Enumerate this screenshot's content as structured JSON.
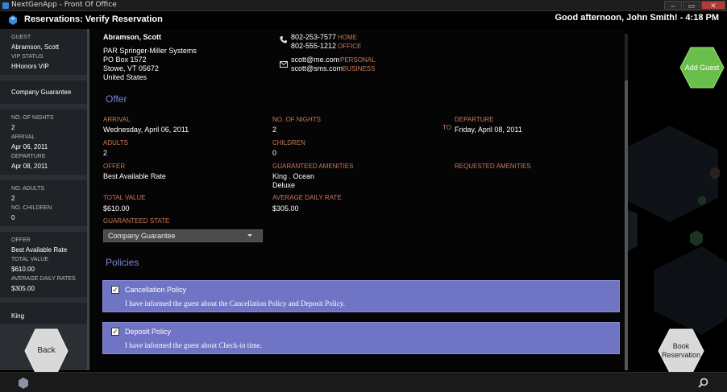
{
  "window": {
    "title": "NextGenApp - Front Of Office",
    "controls": [
      "–",
      "▭",
      "✕"
    ]
  },
  "header": {
    "title": "Reservations: Verify Reservation",
    "greeting": "Good afternoon, John Smith! - 4:18 PM"
  },
  "sidebar": {
    "guest_label": "GUEST",
    "guest_value": "Abramson, Scott",
    "vip_label": "VIP STATUS",
    "vip_value": "HHonors VIP",
    "guarantee": "Company Guarantee",
    "nights_label": "NO. OF NIGHTS",
    "nights_value": "2",
    "arrival_label": "ARRIVAL",
    "arrival_value": "Apr 06, 2011",
    "departure_label": "DEPARTURE",
    "departure_value": "Apr 08, 2011",
    "adults_label": "NO. ADULTS",
    "adults_value": "2",
    "children_label": "NO. CHILDREN",
    "children_value": "0",
    "offer_label": "OFFER",
    "offer_value": "Best Available Rate",
    "total_label": "TOTAL VALUE",
    "total_value": "$610.00",
    "adr_label": "AVERAGE DAILY RATES",
    "adr_value": "$305.00",
    "room_value": "King"
  },
  "contact": {
    "name": "Abramson, Scott",
    "company": "PAR Springer-Miller Systems",
    "address1": "PO Box 1572",
    "address2": "Stowe, VT 05672",
    "country": "United States",
    "phone_home": "802-253-7577",
    "phone_home_type": "HOME",
    "phone_office": "802-555-1212",
    "phone_office_type": "OFFICE",
    "email_personal": "scott@me.com",
    "email_personal_type": "PERSONAL",
    "email_business": "scott@sms.com",
    "email_business_type": "BUSINESS"
  },
  "offer_section": {
    "title": "Offer",
    "arrival_label": "ARRIVAL",
    "arrival_value": "Wednesday, April 06, 2011",
    "nights_label": "NO. OF NIGHTS",
    "nights_value": "2",
    "to": "TO",
    "departure_label": "DEPARTURE",
    "departure_value": "Friday, April 08, 2011",
    "adults_label": "ADULTS",
    "adults_value": "2",
    "children_label": "CHILDREN",
    "children_value": "0",
    "offer_label": "OFFER",
    "offer_value": "Best Available Rate",
    "amenities_label": "GUARANTEED AMENITIES",
    "amenities_line1": "King . Ocean",
    "amenities_line2": "Deluxe",
    "requested_label": "REQUESTED AMENITIES",
    "total_label": "TOTAL VALUE",
    "total_value": "$610.00",
    "adr_label": "AVERAGE DAILY RATE",
    "adr_value": "$305.00",
    "state_label": "GUARANTEED STATE",
    "state_value": "Company Guarantee"
  },
  "policies": {
    "title": "Policies",
    "items": [
      {
        "title": "Cancellation Policy",
        "desc": "I have informed the guest about the Cancellation Policy and Deposit Policy.",
        "checked": true
      },
      {
        "title": "Deposit Policy",
        "desc": "I have informed the guest about Check-in time.",
        "checked": true
      }
    ]
  },
  "buttons": {
    "add_guest": "Add Guest",
    "back": "Back",
    "book_line1": "Book",
    "book_line2": "Reservation"
  },
  "colors": {
    "accent_label": "#c8795a",
    "section_title": "#7a86d6",
    "policy_bg": "#7074c4",
    "add_guest": "#6abf4b"
  },
  "icons": {
    "phone": "phone-icon",
    "mail": "mail-icon",
    "search": "search-icon",
    "logo": "app-logo-icon"
  }
}
